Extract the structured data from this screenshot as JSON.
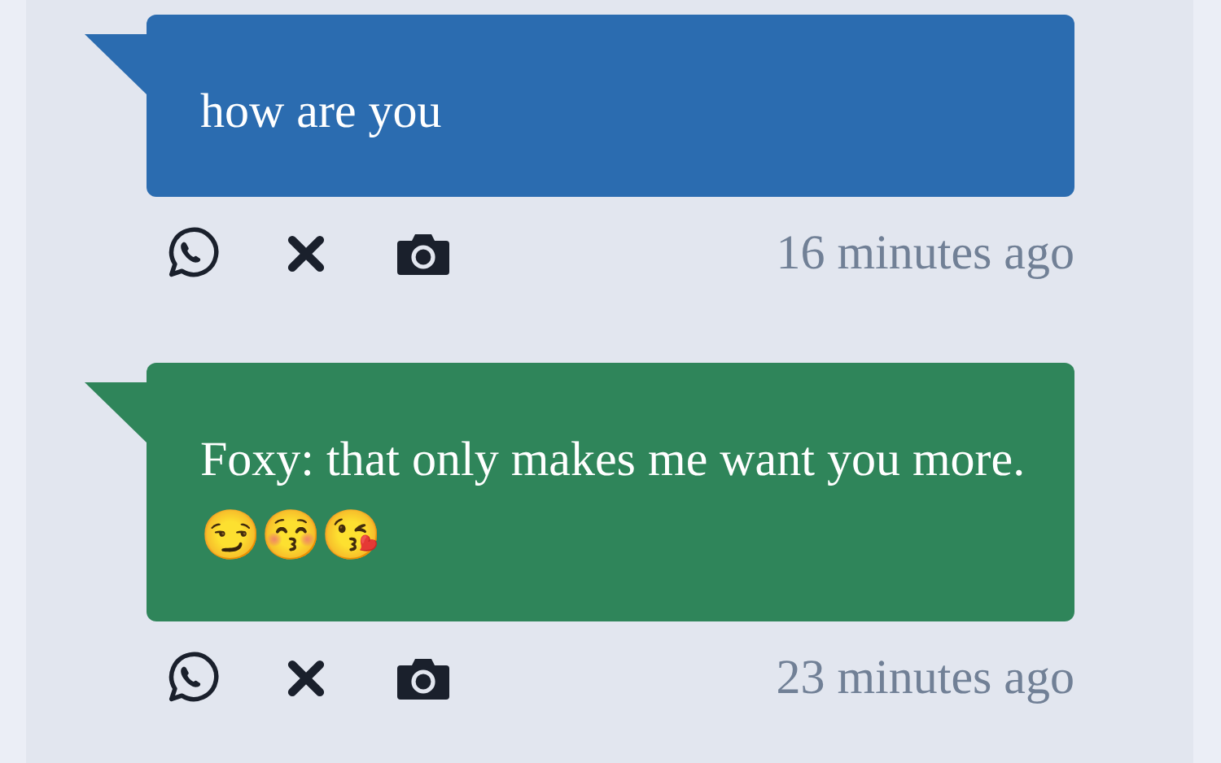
{
  "messages": [
    {
      "text": "how are you",
      "color": "#2b6cb0",
      "time": "16 minutes ago"
    },
    {
      "text": "Foxy: that only makes me want you more.😏😚😘",
      "color": "#2f855a",
      "time": "23 minutes ago"
    }
  ]
}
